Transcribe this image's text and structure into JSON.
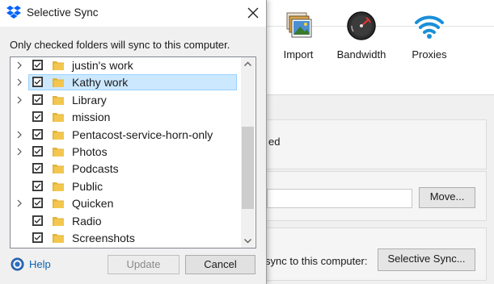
{
  "background_window": {
    "toolbar": [
      {
        "label": "Import",
        "icon": "photos-import-icon"
      },
      {
        "label": "Bandwidth",
        "icon": "speedometer-icon"
      },
      {
        "label": "Proxies",
        "icon": "wifi-icon"
      }
    ],
    "group1_text_fragment": "ed",
    "move_button": "Move...",
    "sync_text_fragment": "sync to this computer:",
    "selective_sync_button": "Selective Sync..."
  },
  "dialog": {
    "title": "Selective Sync",
    "instruction": "Only checked folders will sync to this computer.",
    "folders": [
      {
        "name": "justin's work",
        "expandable": true,
        "checked": true,
        "selected": false
      },
      {
        "name": "Kathy work",
        "expandable": true,
        "checked": true,
        "selected": true
      },
      {
        "name": "Library",
        "expandable": true,
        "checked": true,
        "selected": false
      },
      {
        "name": "mission",
        "expandable": false,
        "checked": true,
        "selected": false
      },
      {
        "name": "Pentacost-service-horn-only",
        "expandable": true,
        "checked": true,
        "selected": false
      },
      {
        "name": "Photos",
        "expandable": true,
        "checked": true,
        "selected": false
      },
      {
        "name": "Podcasts",
        "expandable": false,
        "checked": true,
        "selected": false
      },
      {
        "name": "Public",
        "expandable": false,
        "checked": true,
        "selected": false
      },
      {
        "name": "Quicken",
        "expandable": true,
        "checked": true,
        "selected": false
      },
      {
        "name": "Radio",
        "expandable": false,
        "checked": true,
        "selected": false
      },
      {
        "name": "Screenshots",
        "expandable": false,
        "checked": true,
        "selected": false
      }
    ],
    "help_label": "Help",
    "update_button": "Update",
    "update_enabled": false,
    "cancel_button": "Cancel"
  },
  "colors": {
    "selection_bg": "#cce8ff",
    "selection_border": "#99d1ff",
    "folder_yellow": "#f3c74f",
    "dropbox_blue": "#0061fe",
    "link_blue": "#0b63b5"
  }
}
